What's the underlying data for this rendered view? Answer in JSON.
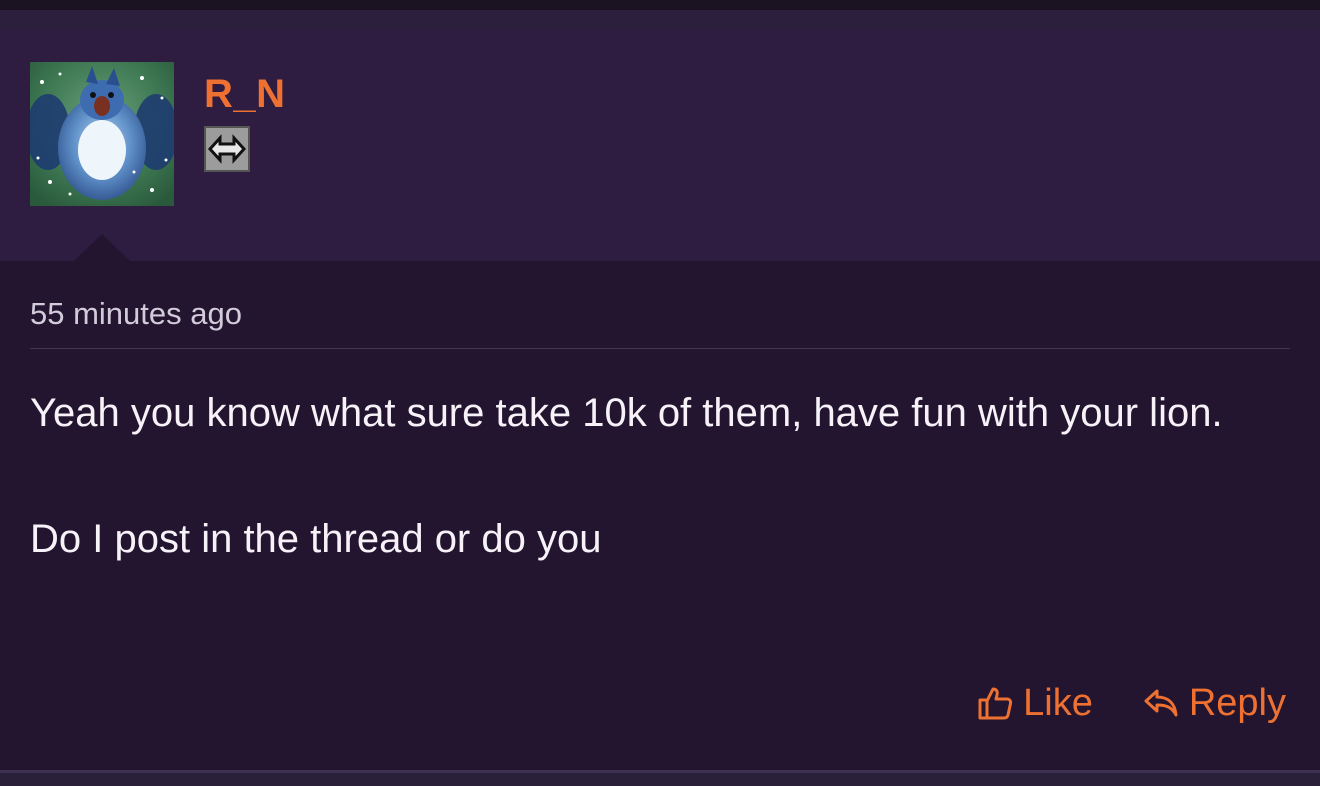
{
  "post": {
    "author": "R_N",
    "timestamp": "55 minutes ago",
    "message": {
      "paragraph1": "Yeah you know what sure take 10k of them, have fun with your lion.",
      "paragraph2": "Do I post in the thread or do you"
    },
    "actions": {
      "like_label": "Like",
      "reply_label": "Reply"
    }
  },
  "icons": {
    "avatar": "bird-avatar",
    "badge": "pixel-badge-icon",
    "like": "thumbs-up-icon",
    "reply": "reply-arrow-icon"
  },
  "colors": {
    "accent": "#ee7131",
    "header_bg": "#2e1c41",
    "body_bg": "#231530",
    "text": "#f6f2f8",
    "muted_text": "#d2cbda"
  }
}
